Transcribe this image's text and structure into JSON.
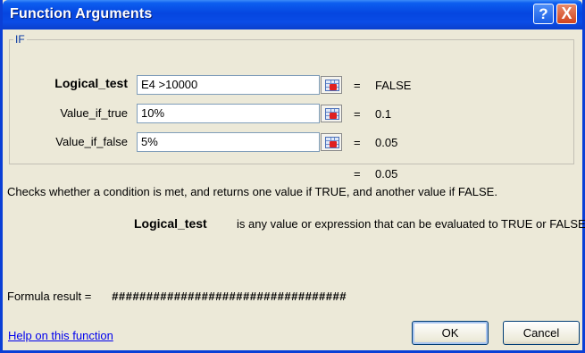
{
  "window": {
    "title": "Function Arguments",
    "help_glyph": "?",
    "close_glyph": "X"
  },
  "function": {
    "name": "IF",
    "arguments": [
      {
        "label": "Logical_test",
        "value": "E4 >10000",
        "equals": "=",
        "result": "FALSE"
      },
      {
        "label": "Value_if_true",
        "value": "10%",
        "equals": "=",
        "result": "0.1"
      },
      {
        "label": "Value_if_false",
        "value": "5%",
        "equals": "=",
        "result": "0.05"
      }
    ],
    "overall_equals": "=",
    "overall_result": "0.05",
    "description": "Checks whether a condition is met, and returns one value if TRUE, and another value if FALSE.",
    "arg_help_name": "Logical_test",
    "arg_help_text": "is any value or expression that can be evaluated to TRUE or FALSE."
  },
  "formula": {
    "label": "Formula result =",
    "value": "##################################"
  },
  "footer": {
    "help_link": "Help on this function",
    "ok_label": "OK",
    "cancel_label": "Cancel"
  },
  "colors": {
    "titlebar": "#0546e0",
    "dialog_bg": "#ece9d8",
    "link": "#0000ee"
  }
}
